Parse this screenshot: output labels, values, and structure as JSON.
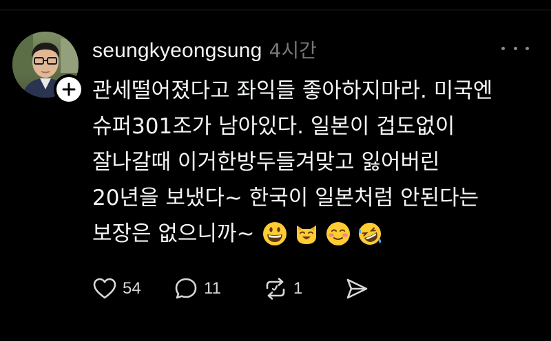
{
  "post": {
    "username": "seungkyeongsung",
    "timestamp": "4시간",
    "text_lines": [
      "관세떨어졌다고 좌익들 좋아하지마라. 미국엔",
      "슈퍼301조가 남아있다. 일본이 겁도없이",
      "잘나갈때 이거한방두들겨맞고 잃어버린",
      "20년을 보냈다~ 한국이 일본처럼 안된다는",
      "보장은 없으니까~"
    ],
    "emojis": [
      "grinning-face-emoji",
      "smiling-cat-emoji",
      "smiling-face-emoji",
      "rolling-on-floor-laughing-emoji"
    ],
    "actions": {
      "likes": "54",
      "replies": "11",
      "reposts": "1"
    }
  },
  "icons": {
    "like": "heart-icon",
    "reply": "speech-bubble-icon",
    "repost": "repost-arrows-icon",
    "share": "send-arrow-icon",
    "more": "more-dots-icon",
    "follow": "plus-icon"
  },
  "colors": {
    "background": "#000000",
    "text": "#f3f5f7",
    "muted": "#777777",
    "icon": "#d8d8d8",
    "emoji": "#ffcc33"
  }
}
